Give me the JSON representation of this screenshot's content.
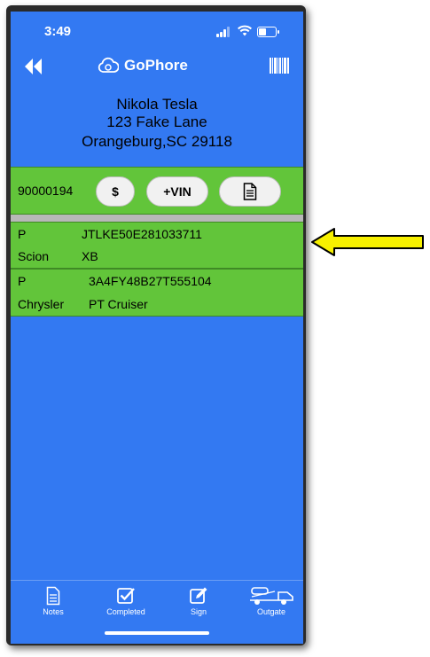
{
  "status": {
    "time": "3:49",
    "battery_level": 0.45
  },
  "header": {
    "app_name": "GoPhore"
  },
  "customer": {
    "name": "Nikola Tesla",
    "street": "123 Fake Lane",
    "city": "Orangeburg,SC 29118"
  },
  "toolbar": {
    "number": "90000194",
    "dollar_label": "$",
    "vin_label": "+VIN",
    "doc_icon": "document-icon"
  },
  "vehicles": [
    {
      "type": "P",
      "vin": "JTLKE50E281033711",
      "make": "Scion",
      "model": "XB"
    },
    {
      "type": "P",
      "vin": "3A4FY48B27T555104",
      "make": "Chrysler",
      "model": "PT Cruiser"
    }
  ],
  "tabs": [
    {
      "label": "Notes",
      "icon": "notes-icon"
    },
    {
      "label": "Completed",
      "icon": "checkbox-icon"
    },
    {
      "label": "Sign",
      "icon": "sign-icon"
    },
    {
      "label": "Outgate",
      "icon": "truck-icon"
    }
  ],
  "colors": {
    "screen_bg": "#3379f2",
    "row_green": "#62c53a",
    "arrow_yellow": "#f7f000"
  }
}
